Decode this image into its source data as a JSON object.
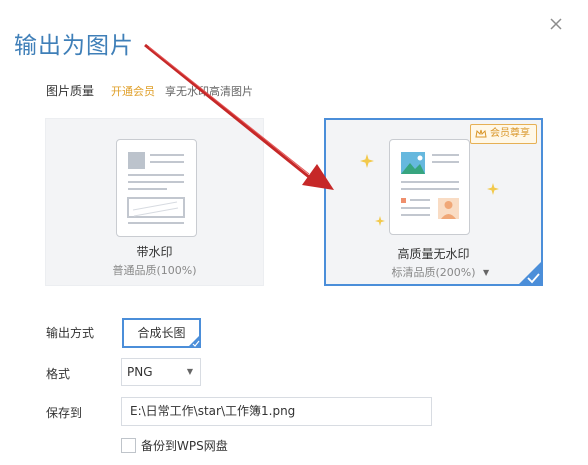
{
  "dialog": {
    "title": "输出为图片"
  },
  "quality": {
    "label": "图片质量",
    "vip_link": "开通会员",
    "note": "享无水印高清图片"
  },
  "options": [
    {
      "title": "带水印",
      "subtitle": "普通品质(100%)"
    },
    {
      "title": "高质量无水印",
      "subtitle": "标清品质(200%)",
      "badge": "会员尊享"
    }
  ],
  "export": {
    "mode_label": "输出方式",
    "mode_value": "合成长图",
    "format_label": "格式",
    "format_value": "PNG",
    "save_label": "保存到",
    "save_path": "E:\\日常工作\\star\\工作簿1.png",
    "backup_label": "备份到WPS网盘"
  },
  "colors": {
    "accent": "#4b8ed9",
    "title": "#3f7fb8",
    "vip": "#e0a02b",
    "arrow": "#c62828"
  },
  "icons": {
    "close": "close-icon",
    "crown": "crown-icon",
    "check": "checkmark-icon",
    "dropdown": "chevron-down-icon",
    "arrow": "red-arrow-annotation"
  }
}
